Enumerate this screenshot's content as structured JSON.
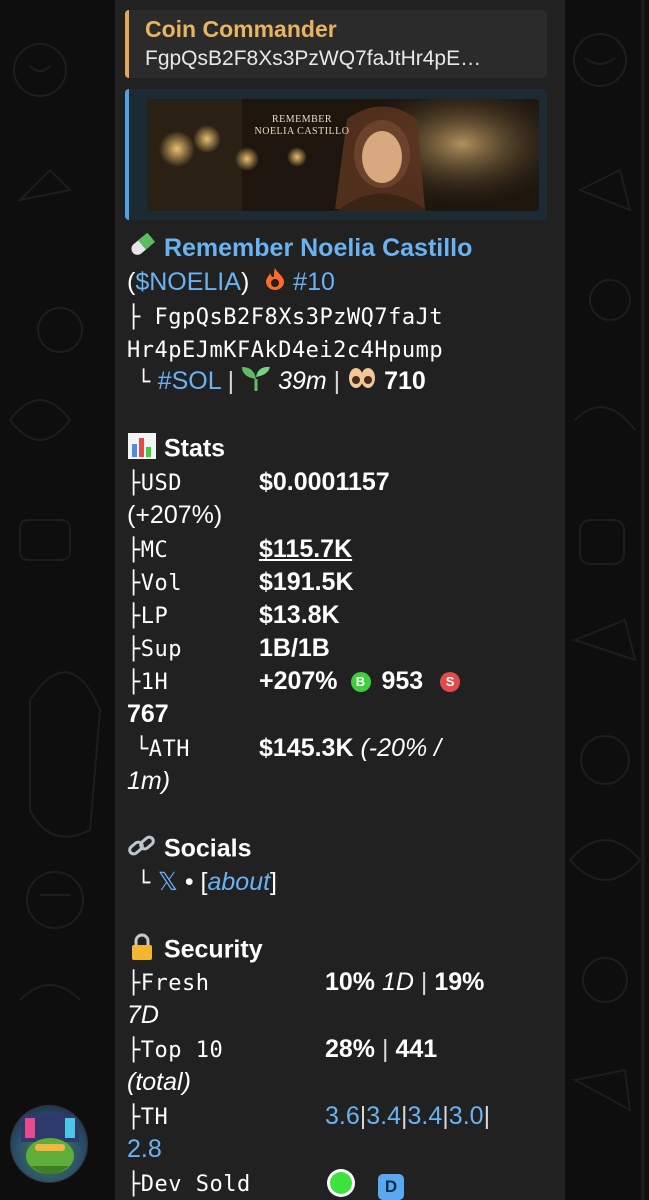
{
  "reply": {
    "title": "Coin Commander",
    "text": "FgpQsB2F8Xs3PzWQ7faJtHr4pE…"
  },
  "media": {
    "caption_line1": "REMEMBER",
    "caption_line2": "NOELIA CASTILLO"
  },
  "token": {
    "name": "Remember Noelia Castillo",
    "ticker_open": "(",
    "ticker": "$NOELIA",
    "ticker_close": ")",
    "rank": "#10",
    "address_line1": "FgpQsB2F8Xs3PzWQ7faJt",
    "address_line2": "Hr4pEJmKFAkD4ei2c4Hpump",
    "chain": "#SOL",
    "age": "39m",
    "views": "710"
  },
  "stats": {
    "heading": "Stats",
    "usd_label": "USD",
    "usd_value": "$0.0001157",
    "usd_change": "(+207%)",
    "mc_label": "MC",
    "mc_value": "$115.7K",
    "vol_label": "Vol",
    "vol_value": "$191.5K",
    "lp_label": "LP",
    "lp_value": "$13.8K",
    "sup_label": "Sup",
    "sup_value": "1B/1B",
    "h1_label": "1H",
    "h1_change": "+207%",
    "h1_buy_badge": "B",
    "h1_buys": "953",
    "h1_sell_badge": "S",
    "h1_sells": "767",
    "ath_label": "ATH",
    "ath_value": "$145.3K",
    "ath_note_a": "(-20% /",
    "ath_note_b": "1m)"
  },
  "socials": {
    "heading": "Socials",
    "x_label": "𝕏",
    "sep": "•",
    "about_open": "[",
    "about": "about",
    "about_close": "]"
  },
  "security": {
    "heading": "Security",
    "fresh_label": "Fresh",
    "fresh_1d_pct": "10%",
    "fresh_1d": "1D",
    "fresh_7d_pct": "19%",
    "fresh_7d": "7D",
    "top10_label": "Top 10",
    "top10_pct": "28%",
    "top10_count": "441",
    "top10_total": "(total)",
    "th_label": "TH",
    "th_values": [
      "3.6",
      "3.4",
      "3.4",
      "3.0",
      "2.8"
    ],
    "dev_label": "Dev Sold",
    "dev_badge": "D"
  },
  "tree": {
    "branch": "├",
    "end": "└",
    "pipe": "|"
  },
  "colors": {
    "link": "#6ab3f3",
    "accent_orange": "#e9b460",
    "bubble": "#212121",
    "buy_green": "#3ecf3e",
    "sell_red": "#e14b4b"
  }
}
